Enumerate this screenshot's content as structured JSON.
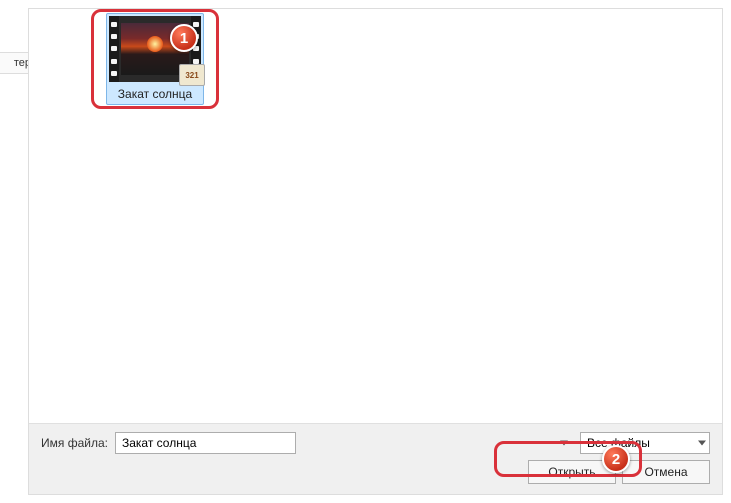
{
  "sidebar": {
    "fragment_text": "тер"
  },
  "file": {
    "name": "Закат солнца",
    "player_badge": "321"
  },
  "markers": {
    "one": "1",
    "two": "2"
  },
  "bottom": {
    "filename_label": "Имя файла:",
    "filename_value": "Закат солнца",
    "filter_value": "Все файлы",
    "open_label": "Открыть",
    "cancel_label": "Отмена"
  }
}
